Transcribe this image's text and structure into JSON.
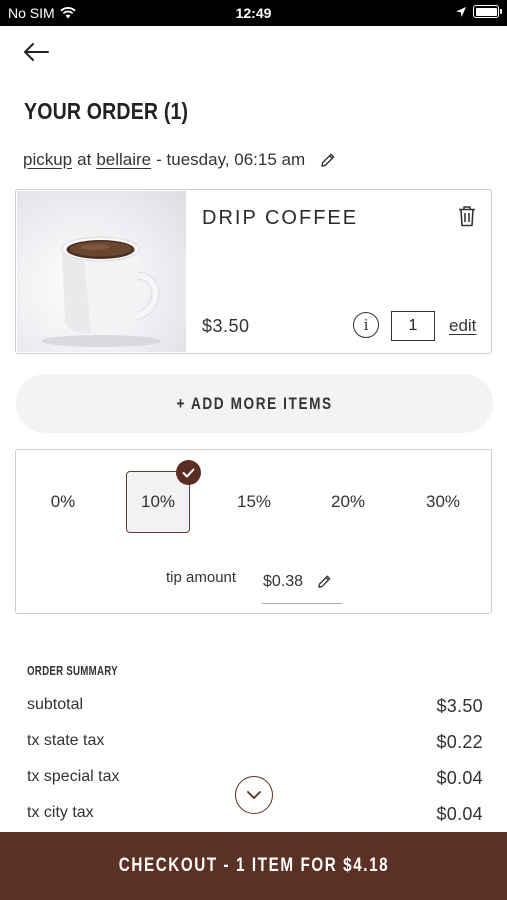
{
  "status_bar": {
    "carrier": "No SIM",
    "time": "12:49"
  },
  "header": {
    "title": "YOUR ORDER (1)"
  },
  "order_info": {
    "mode": "pickup",
    "at": "at",
    "location": "bellaire",
    "schedule": "- tuesday, 06:15 am"
  },
  "item": {
    "name": "DRIP COFFEE",
    "price": "$3.50",
    "info_label": "i",
    "quantity": "1",
    "edit_label": "edit"
  },
  "add_more_label": "+ ADD MORE ITEMS",
  "tip": {
    "options": [
      "0%",
      "10%",
      "15%",
      "20%",
      "30%"
    ],
    "selected": "10%",
    "amount_label": "tip amount",
    "amount": "$0.38"
  },
  "summary": {
    "title": "ORDER SUMMARY",
    "rows": [
      {
        "label": "subtotal",
        "value": "$3.50"
      },
      {
        "label": "tx state tax",
        "value": "$0.22"
      },
      {
        "label": "tx special tax",
        "value": "$0.04"
      },
      {
        "label": "tx city tax",
        "value": "$0.04"
      }
    ]
  },
  "checkout_label": "CHECKOUT - 1 ITEM FOR $4.18",
  "colors": {
    "brand": "#5b3025",
    "accent": "#6b3a2e",
    "pill_bg": "#f3f2f5"
  }
}
